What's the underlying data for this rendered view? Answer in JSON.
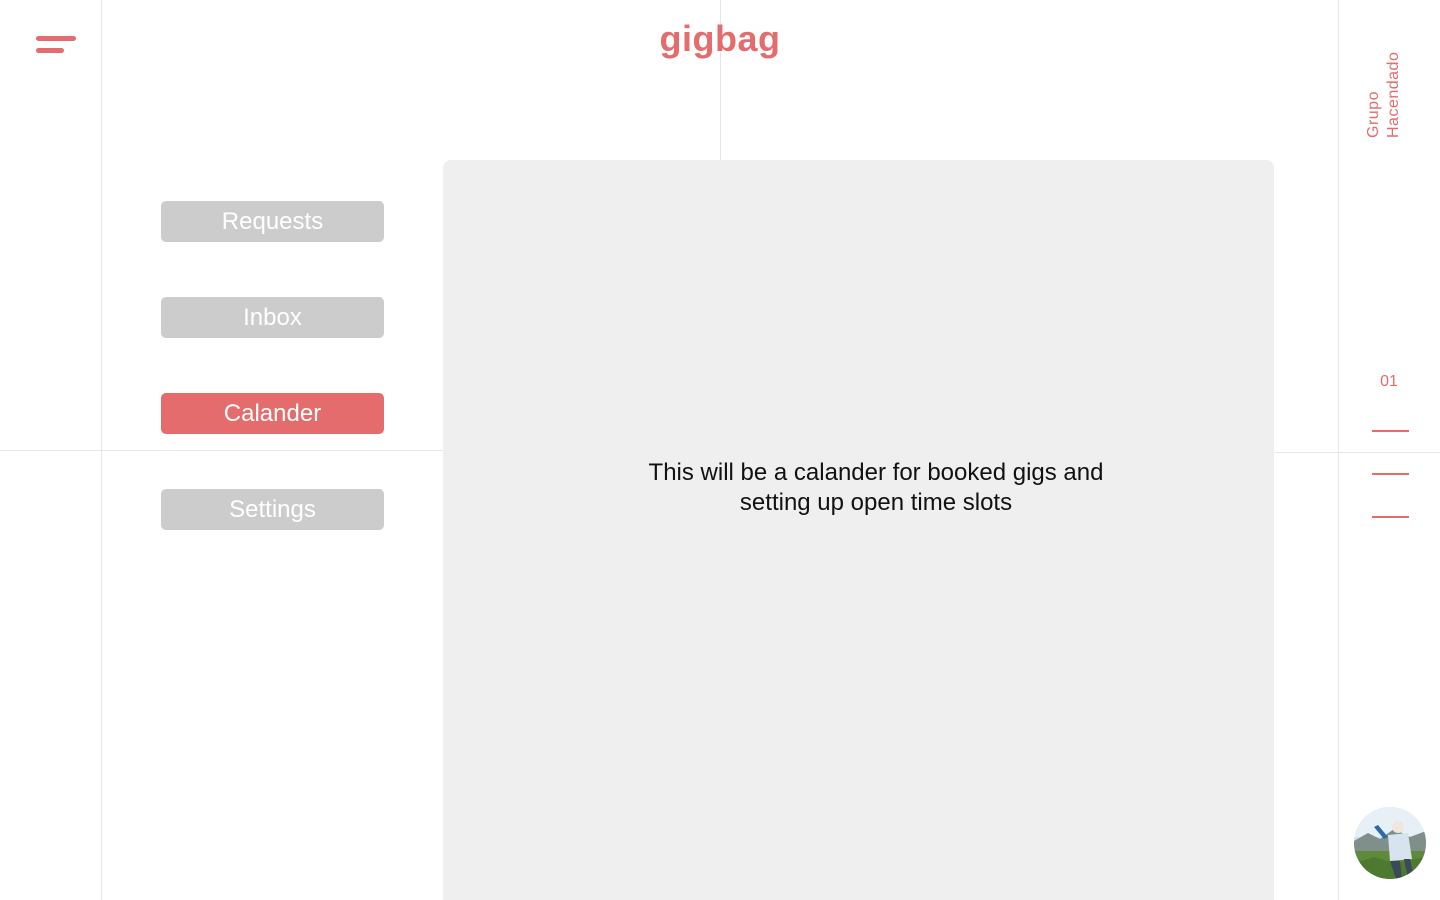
{
  "header": {
    "logo": "gigbag",
    "menu_icon": "hamburger-menu-icon"
  },
  "nav": {
    "items": [
      {
        "label": "Requests",
        "active": false
      },
      {
        "label": "Inbox",
        "active": false
      },
      {
        "label": "Calander",
        "active": true
      },
      {
        "label": "Settings",
        "active": false
      }
    ]
  },
  "main": {
    "placeholder_text": "This will be a calander for booked gigs and\nsetting up open time slots"
  },
  "sidebar_right": {
    "brand": "Grupo\nHacendado",
    "page_number": "01",
    "avatar_icon": "user-avatar"
  },
  "colors": {
    "accent": "#e46c6c",
    "inactive_button": "#cccccc",
    "panel": "#efefef",
    "grid_line": "#e6e6e6"
  }
}
